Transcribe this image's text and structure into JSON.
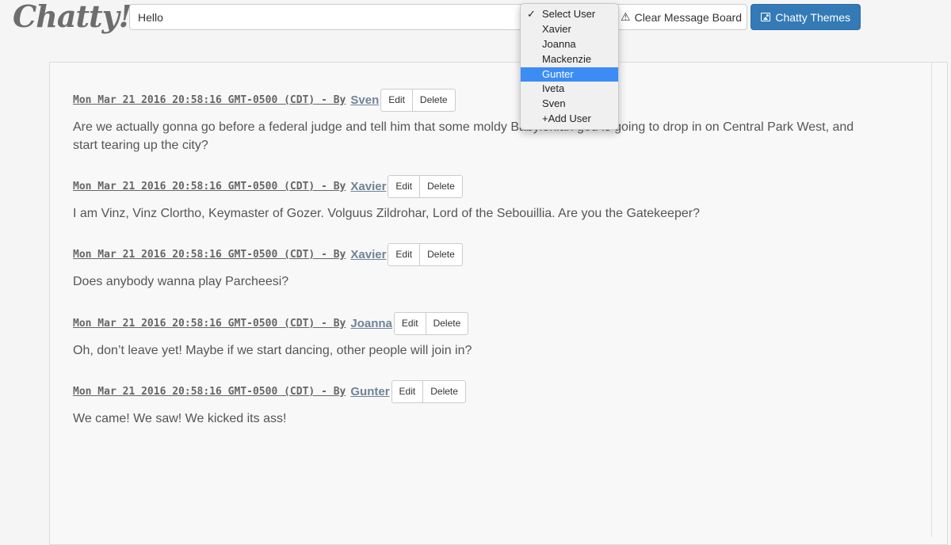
{
  "app": {
    "logo": "Chatty!"
  },
  "composer": {
    "message_value": "Hello"
  },
  "user_dropdown": {
    "check_glyph": "✓",
    "options": [
      "Select User",
      "Xavier",
      "Joanna",
      "Mackenzie",
      "Gunter",
      "Iveta",
      "Sven",
      "+Add User"
    ],
    "checked": "Select User",
    "highlighted": "Gunter",
    "highlight_color": "#3b8cf5"
  },
  "toolbar": {
    "clear_label": "Clear Message Board",
    "clear_icon": "warning-icon",
    "themes_label": "Chatty Themes",
    "themes_icon": "image-icon",
    "themes_color": "#337ab7"
  },
  "messages": [
    {
      "meta": "Mon Mar 21 2016 20:58:16 GMT-0500 (CDT) - By",
      "author": "Sven",
      "edit_label": "Edit",
      "delete_label": "Delete",
      "text": "Are we actually gonna go before a federal judge and tell him that some moldy Babylonian god is going to drop in on Central Park West, and start tearing up the city?"
    },
    {
      "meta": "Mon Mar 21 2016 20:58:16 GMT-0500 (CDT) - By",
      "author": "Xavier",
      "edit_label": "Edit",
      "delete_label": "Delete",
      "text": "I am Vinz, Vinz Clortho, Keymaster of Gozer. Volguus Zildrohar, Lord of the Sebouillia. Are you the Gatekeeper?"
    },
    {
      "meta": "Mon Mar 21 2016 20:58:16 GMT-0500 (CDT) - By",
      "author": "Xavier",
      "edit_label": "Edit",
      "delete_label": "Delete",
      "text": "Does anybody wanna play Parcheesi?"
    },
    {
      "meta": "Mon Mar 21 2016 20:58:16 GMT-0500 (CDT) - By",
      "author": "Joanna",
      "edit_label": "Edit",
      "delete_label": "Delete",
      "text": "Oh, don’t leave yet! Maybe if we start dancing, other people will join in?"
    },
    {
      "meta": "Mon Mar 21 2016 20:58:16 GMT-0500 (CDT) - By",
      "author": "Gunter",
      "edit_label": "Edit",
      "delete_label": "Delete",
      "text": "We came! We saw! We kicked its ass!"
    }
  ]
}
